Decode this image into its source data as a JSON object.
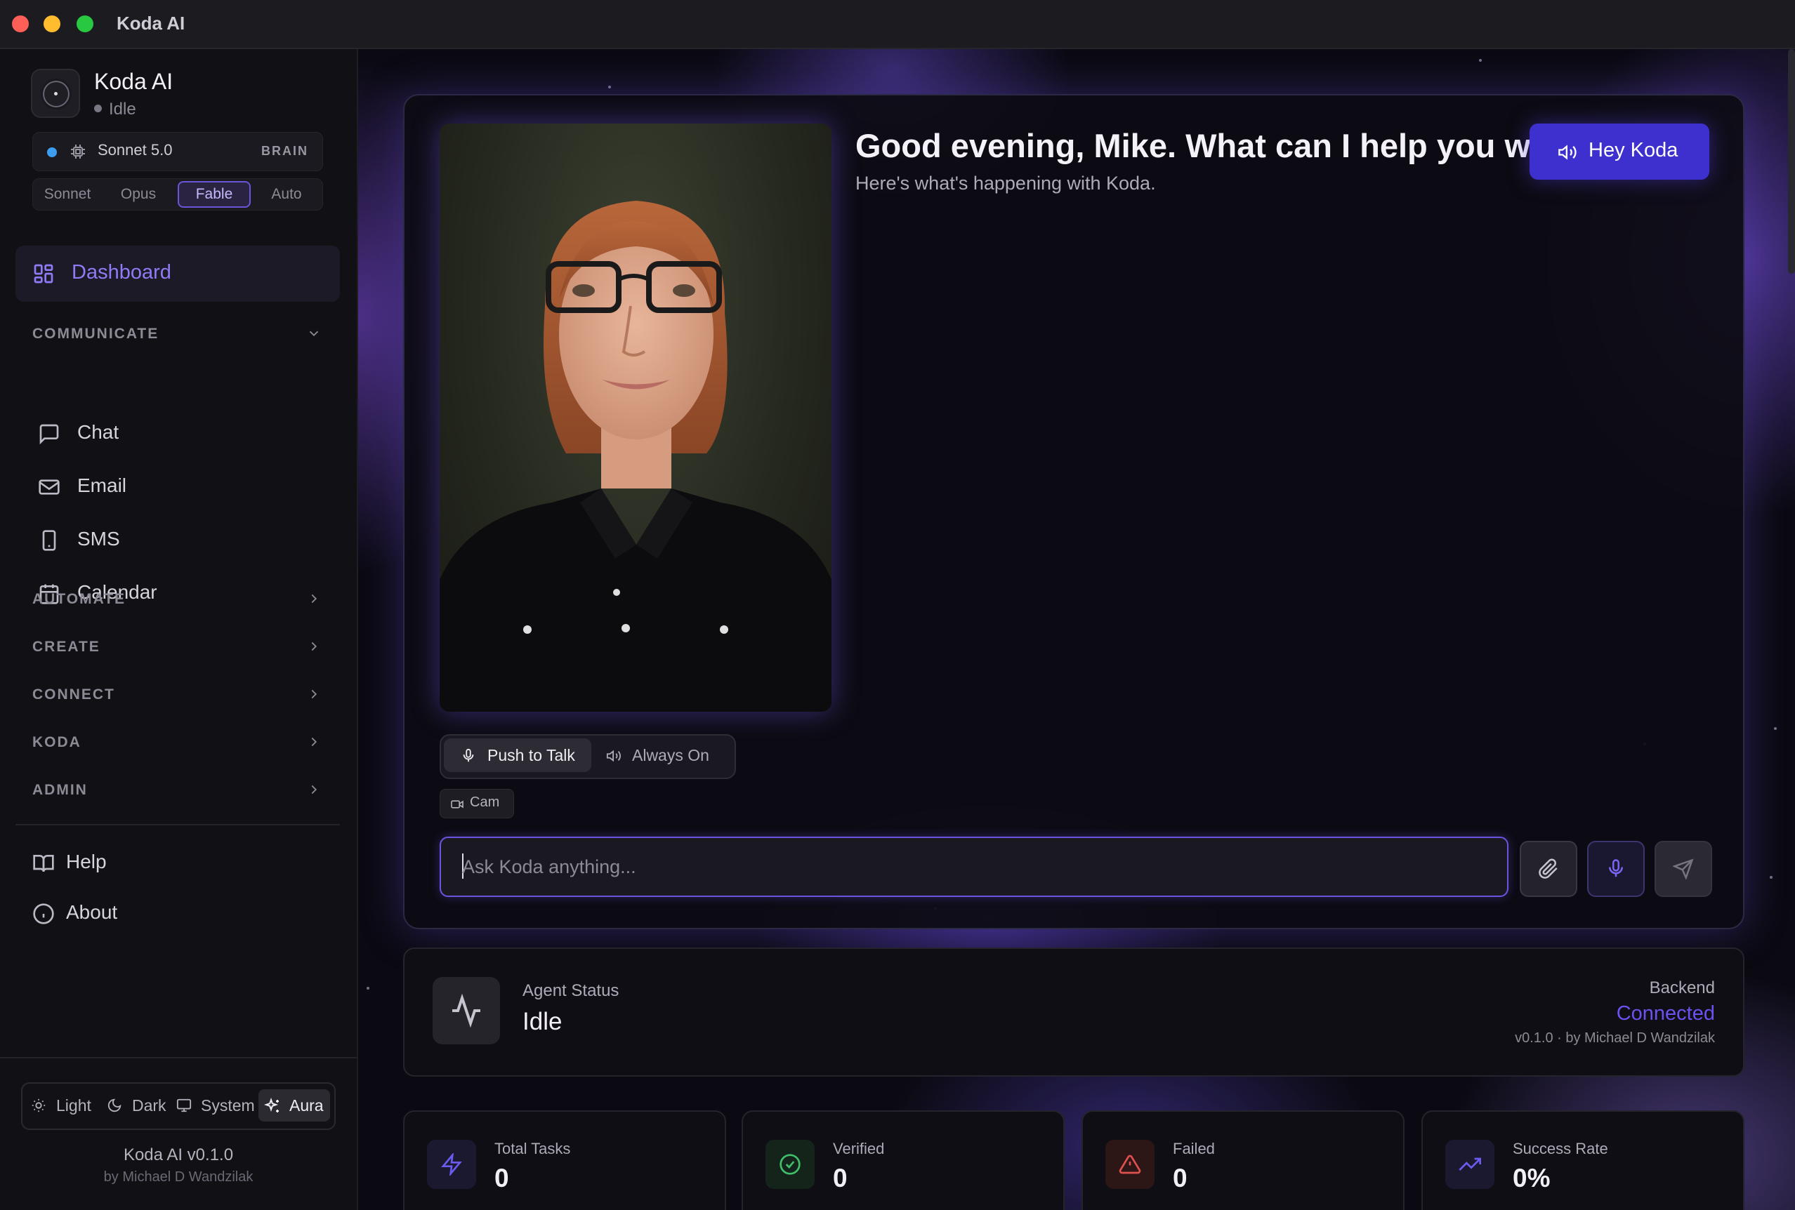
{
  "window": {
    "title": "Koda AI"
  },
  "sidebar": {
    "app_name": "Koda AI",
    "app_status": "Idle",
    "model": {
      "name": "Sonnet 5.0",
      "tag": "BRAIN",
      "indicator_color": "#3d9df0"
    },
    "model_tabs": [
      "Sonnet",
      "Opus",
      "Fable",
      "Auto"
    ],
    "model_tab_selected": "Fable",
    "active_item": {
      "label": "Dashboard",
      "icon": "dashboard-icon"
    },
    "sections": {
      "communicate": {
        "label": "COMMUNICATE",
        "expanded": true,
        "items": [
          {
            "label": "Chat",
            "icon": "chat-icon"
          },
          {
            "label": "Email",
            "icon": "mail-icon"
          },
          {
            "label": "SMS",
            "icon": "phone-icon"
          },
          {
            "label": "Calendar",
            "icon": "calendar-icon"
          }
        ]
      },
      "automate": {
        "label": "AUTOMATE"
      },
      "create": {
        "label": "CREATE"
      },
      "connect": {
        "label": "CONNECT"
      },
      "koda": {
        "label": "KODA"
      },
      "admin": {
        "label": "ADMIN"
      }
    },
    "bottom_items": [
      {
        "label": "Help",
        "icon": "book-icon"
      },
      {
        "label": "About",
        "icon": "info-icon"
      }
    ],
    "themes": [
      {
        "label": "Light",
        "icon": "sun-icon"
      },
      {
        "label": "Dark",
        "icon": "moon-icon"
      },
      {
        "label": "System",
        "icon": "monitor-icon"
      },
      {
        "label": "Aura",
        "icon": "sparkles-icon"
      }
    ],
    "theme_selected": "Aura",
    "version": "Koda AI v0.1.0",
    "author": "by Michael D Wandzilak"
  },
  "hero": {
    "greeting": "Good evening, Mike. What can I help you with",
    "subtitle": "Here's what's happening with Koda.",
    "hey_button": "Hey Koda",
    "voice_modes": [
      "Push to Talk",
      "Always On"
    ],
    "voice_mode_selected": "Push to Talk",
    "cam_label": "Cam",
    "input_placeholder": "Ask Koda anything...",
    "input_value": ""
  },
  "status": {
    "label": "Agent Status",
    "value": "Idle",
    "backend_label": "Backend",
    "backend_value": "Connected",
    "backend_version": "v0.1.0 · by Michael D Wandzilak"
  },
  "stats": [
    {
      "label": "Total Tasks",
      "value": "0",
      "icon": "bolt-icon",
      "color": "#6b5cf0"
    },
    {
      "label": "Verified",
      "value": "0",
      "icon": "check-circle-icon",
      "color": "#3fbf6a"
    },
    {
      "label": "Failed",
      "value": "0",
      "icon": "alert-triangle-icon",
      "color": "#e0504d"
    },
    {
      "label": "Success Rate",
      "value": "0%",
      "icon": "trending-up-icon",
      "color": "#6b5cf0"
    }
  ],
  "colors": {
    "accent": "#6b52f0",
    "button": "#3e2fcf",
    "background": "#0b0a10"
  }
}
